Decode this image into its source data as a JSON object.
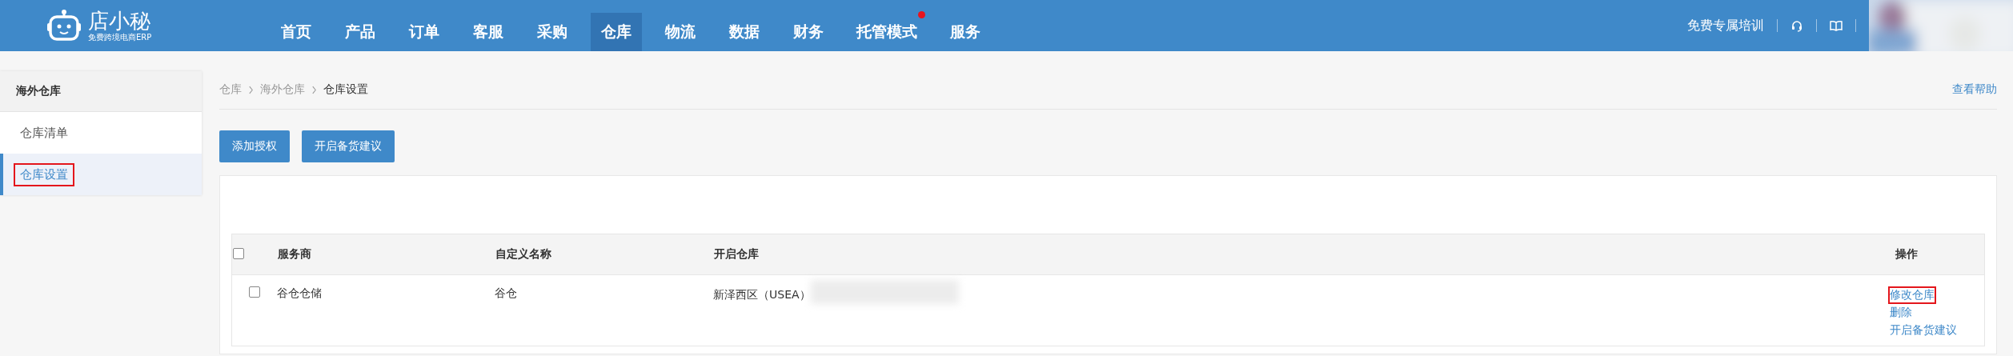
{
  "header": {
    "logo": {
      "name": "店小秘",
      "tagline": "免费跨境电商ERP"
    },
    "nav": [
      {
        "label": "首页",
        "selected": false,
        "dot": false
      },
      {
        "label": "产品",
        "selected": false,
        "dot": false
      },
      {
        "label": "订单",
        "selected": false,
        "dot": false
      },
      {
        "label": "客服",
        "selected": false,
        "dot": false
      },
      {
        "label": "采购",
        "selected": false,
        "dot": false
      },
      {
        "label": "仓库",
        "selected": true,
        "dot": false
      },
      {
        "label": "物流",
        "selected": false,
        "dot": false
      },
      {
        "label": "数据",
        "selected": false,
        "dot": false
      },
      {
        "label": "财务",
        "selected": false,
        "dot": false
      },
      {
        "label": "托管模式",
        "selected": false,
        "dot": true
      },
      {
        "label": "服务",
        "selected": false,
        "dot": false
      }
    ],
    "training_link": "免费专属培训"
  },
  "sidebar": {
    "title": "海外仓库",
    "items": [
      {
        "label": "仓库清单",
        "selected": false,
        "annotated": false
      },
      {
        "label": "仓库设置",
        "selected": true,
        "annotated": true
      }
    ]
  },
  "breadcrumb": [
    "仓库",
    "海外仓库",
    "仓库设置"
  ],
  "help_link": "查看帮助",
  "buttons": [
    "添加授权",
    "开启备货建议"
  ],
  "table": {
    "columns": [
      "服务商",
      "自定义名称",
      "开启仓库",
      "操作"
    ],
    "header_checked": false,
    "rows": [
      {
        "checked": false,
        "cells": [
          "谷仓仓储",
          "谷仓",
          "新泽西区（USEA）"
        ],
        "actions": [
          {
            "label": "修改仓库",
            "annotated": true
          },
          {
            "label": "删除",
            "annotated": false
          },
          {
            "label": "开启备货建议",
            "annotated": false
          }
        ]
      }
    ]
  }
}
